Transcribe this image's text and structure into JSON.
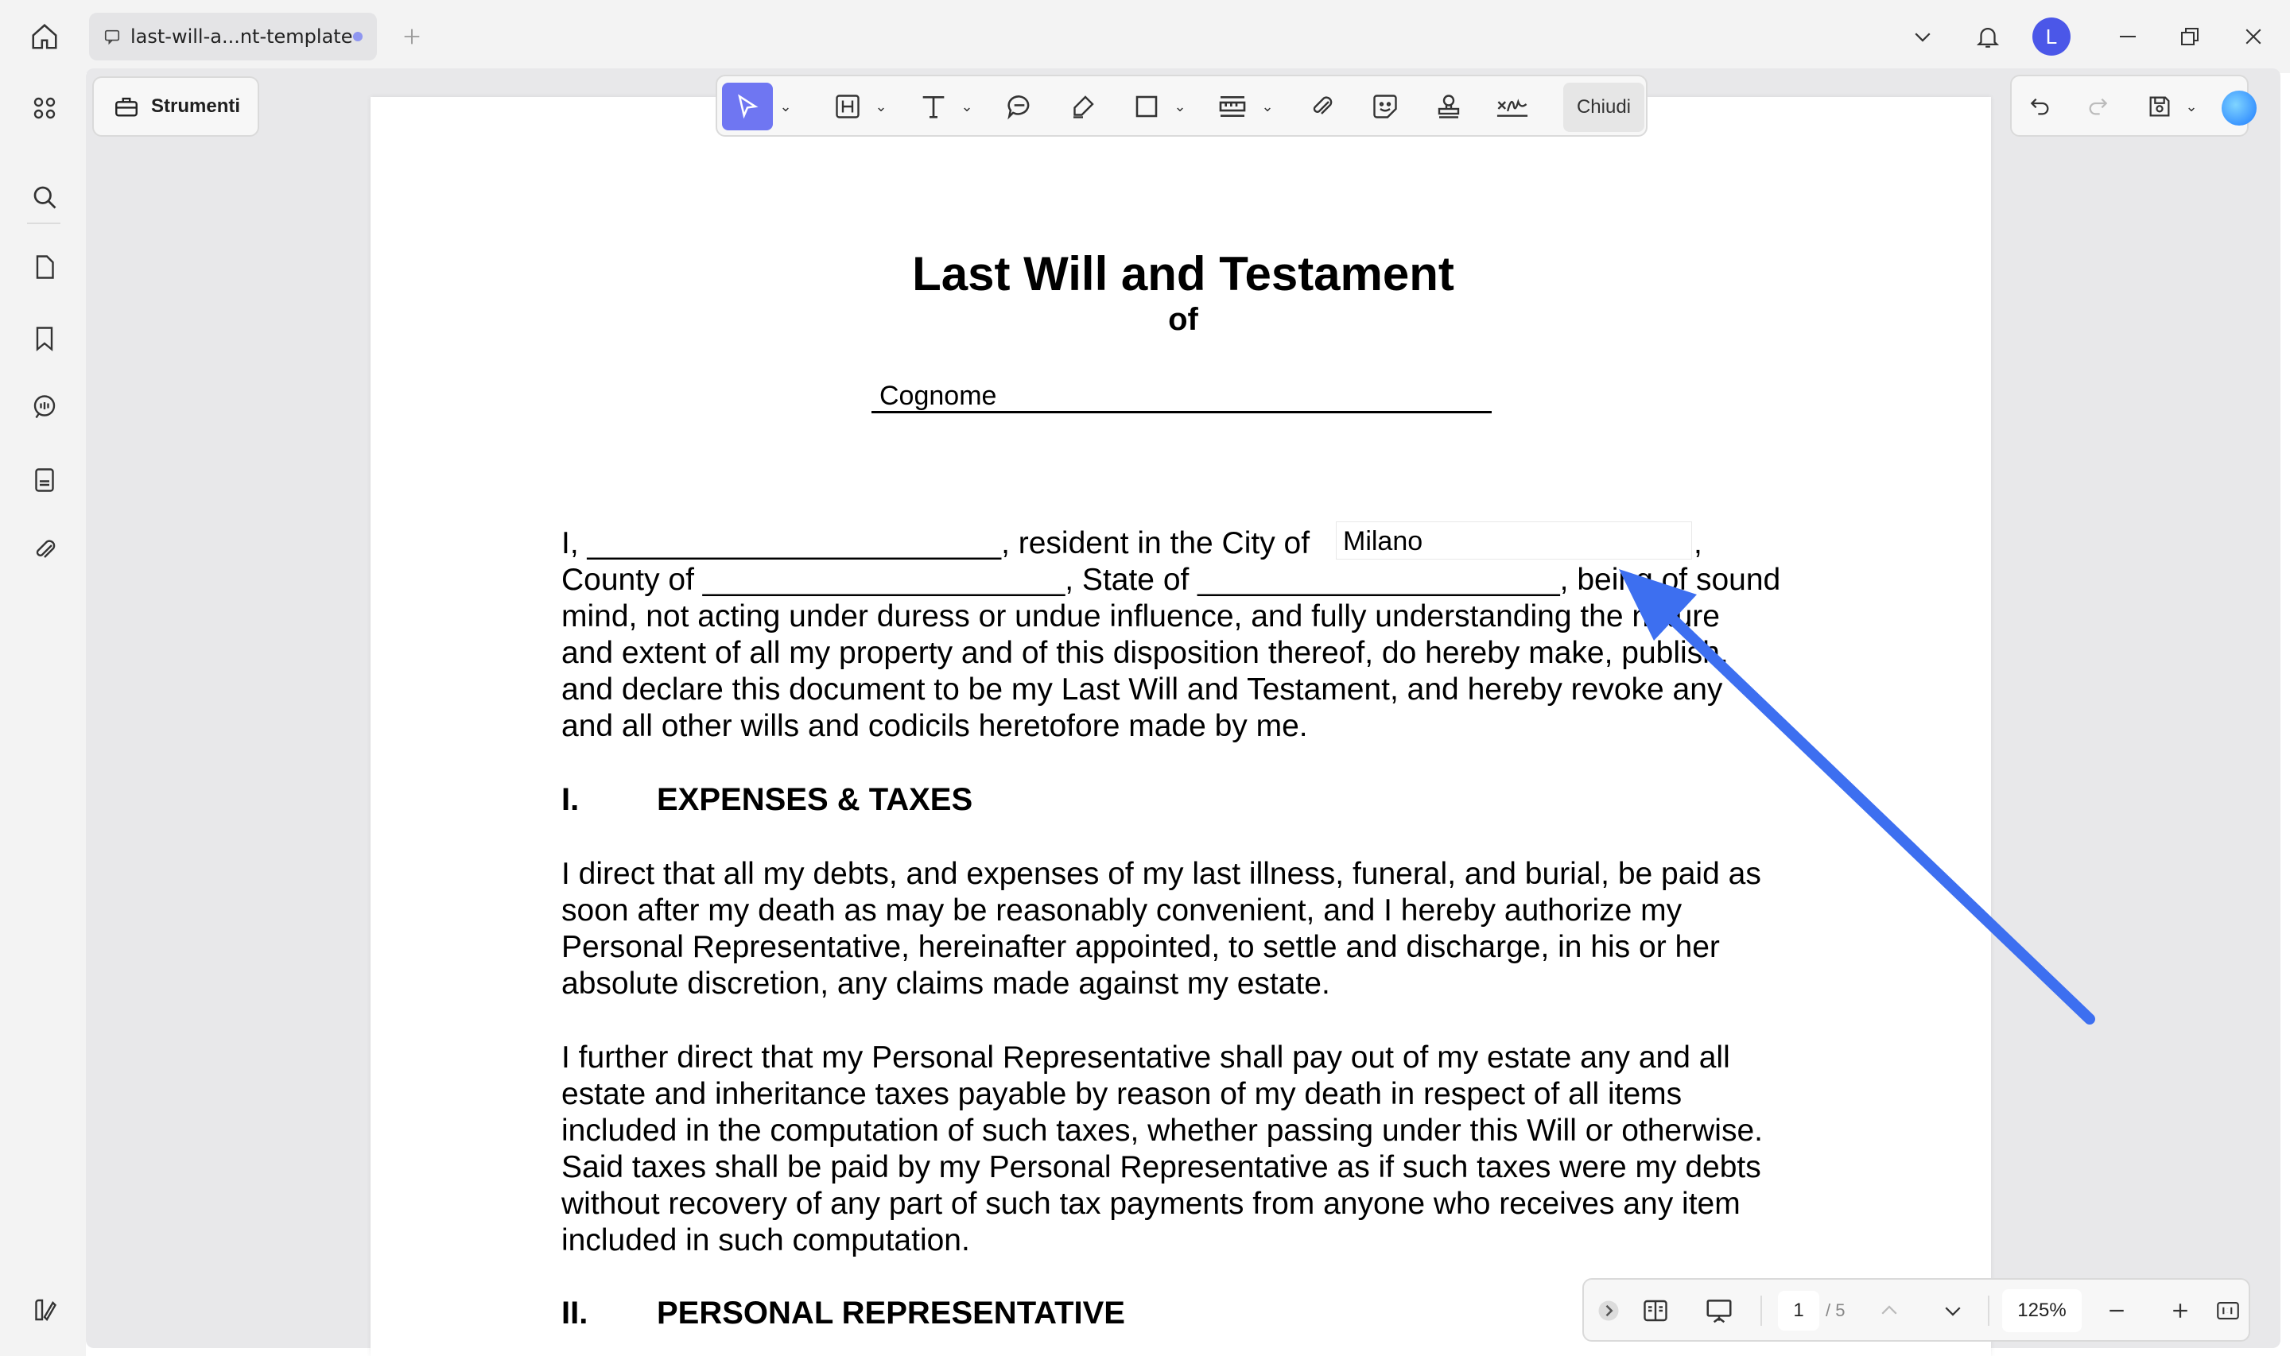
{
  "tab": {
    "title": "last-will-a...nt-template"
  },
  "user": {
    "initial": "L"
  },
  "sidebar": {
    "tools_label": "Strumenti"
  },
  "toolbar": {
    "close_label": "Chiudi"
  },
  "document": {
    "title": "Last Will and Testament",
    "of": "of",
    "name_field": "Cognome",
    "intro_lines": [
      "I, ________________________, resident in the City of",
      "County of _____________________, State of _____________________, being of sound",
      "mind, not acting under duress or undue influence, and fully understanding the nature",
      "and extent of all my property and of this disposition thereof, do hereby make, publish,",
      "and declare this document to be my Last Will and Testament, and hereby revoke any",
      "and all other wills and codicils heretofore made by me."
    ],
    "city_value": "Milano",
    "city_trailing": ",",
    "section1_num": "I.",
    "section1_title": "EXPENSES & TAXES",
    "para1_lines": [
      "I direct that all my debts, and expenses of my last illness, funeral, and burial, be paid as",
      "soon after my death as may be reasonably convenient, and I hereby authorize my",
      "Personal Representative, hereinafter appointed, to settle and discharge, in his or her",
      "absolute discretion, any claims made against my estate."
    ],
    "para2_lines": [
      "I further direct that my Personal Representative shall pay out of my estate any and all",
      "estate and inheritance taxes payable by reason of my death in respect of all items",
      "included in the computation of such taxes, whether passing under this Will or otherwise.",
      "Said taxes shall be paid by my Personal Representative as if such taxes were my debts",
      "without recovery of any part of such tax payments from anyone who receives any item",
      "included in such computation."
    ],
    "section2_num": "II.",
    "section2_title": "PERSONAL REPRESENTATIVE"
  },
  "navigation": {
    "current_page": "1",
    "total_pages": "/ 5",
    "zoom": "125%"
  },
  "colors": {
    "accent": "#6f76f2",
    "annotation_arrow": "#3d6ff0"
  }
}
